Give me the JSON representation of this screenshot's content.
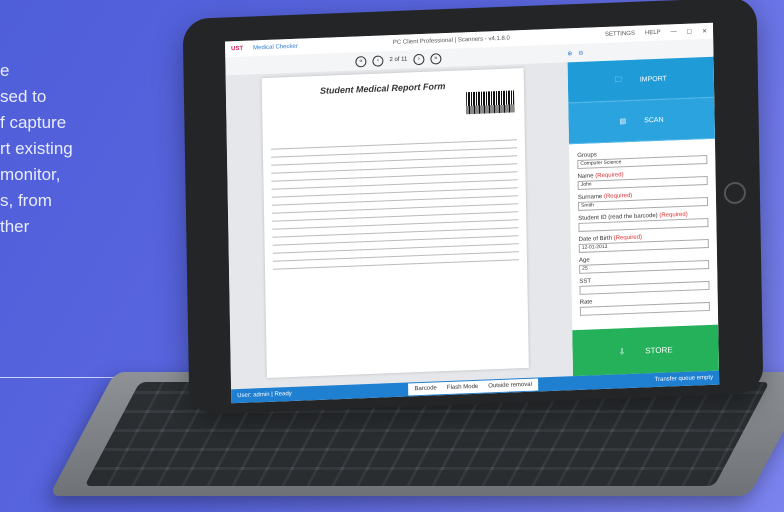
{
  "side_text_lines": [
    "e",
    "sed to",
    "f capture",
    "rt existing",
    "monitor,",
    "s, from",
    "ther"
  ],
  "app": {
    "brand": "UST",
    "name": "Medical Checker",
    "title": "PC Client Professional | Scanners - v4.1.8.0",
    "top_right": [
      "SETTINGS",
      "HELP",
      "—",
      "☐",
      "✕"
    ],
    "page_indicator": "2 of 11"
  },
  "document": {
    "title": "Student Medical Report Form"
  },
  "panel": {
    "import_label": "IMPORT",
    "scan_label": "SCAN",
    "store_label": "STORE",
    "fields": [
      {
        "label": "Groups",
        "required": "",
        "value": "Computer Science"
      },
      {
        "label": "Name",
        "required": "(Required)",
        "value": "John"
      },
      {
        "label": "Surname",
        "required": "(Required)",
        "value": "Smith"
      },
      {
        "label": "Student ID (read the barcode)",
        "required": "(Required)",
        "value": ""
      },
      {
        "label": "Date of Birth",
        "required": "(Required)",
        "value": "12-01-2013"
      },
      {
        "label": "Age",
        "required": "",
        "value": "25"
      },
      {
        "label": "SST",
        "required": "",
        "value": ""
      },
      {
        "label": "Rate",
        "required": "",
        "value": ""
      }
    ]
  },
  "status": {
    "user": "User: admin | Ready",
    "services": [
      "Barcode",
      "Flash Mode",
      "Outside removal"
    ],
    "right": "Transfer queue empty"
  },
  "colors": {
    "accent": "#1f9bd8",
    "store": "#25b15a",
    "status": "#1f7fd0"
  }
}
